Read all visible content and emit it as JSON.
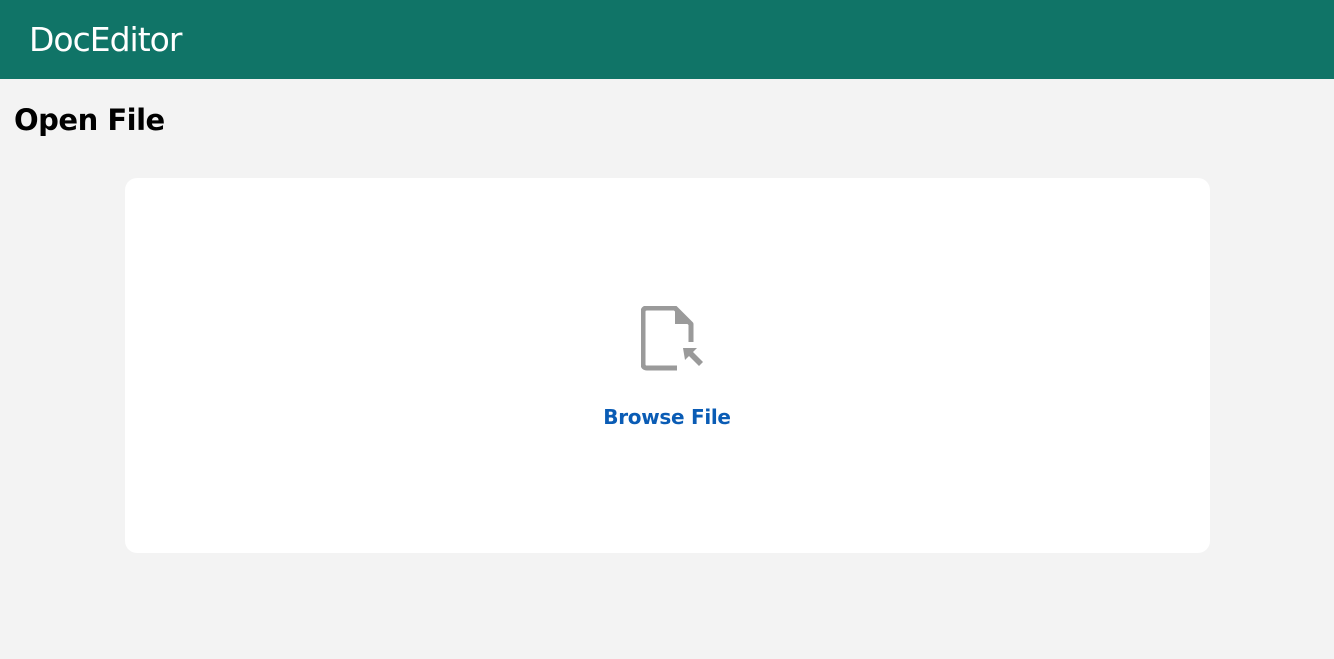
{
  "app": {
    "title": "DocEditor"
  },
  "page": {
    "title": "Open File"
  },
  "drop_zone": {
    "icon": "file-pointer-icon",
    "browse_label": "Browse File"
  },
  "colors": {
    "header_bg": "#107467",
    "page_bg": "#f3f3f3",
    "card_bg": "#ffffff",
    "link": "#0a5cb5",
    "icon": "#9a9a9a"
  }
}
